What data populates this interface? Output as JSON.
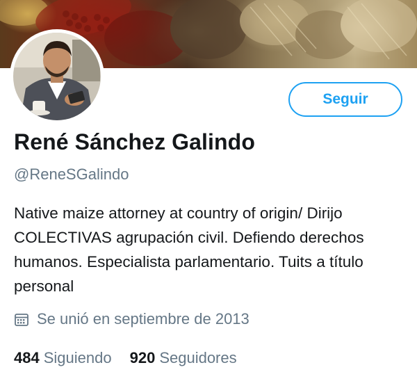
{
  "profile": {
    "name": "René Sánchez Galindo",
    "handle": "@ReneSGalindo",
    "bio": "Native maize attorney at country of origin/ Dirijo COLECTIVAS agrupación civil. Defiendo derechos humanos. Especialista parlamentario. Tuits a título personal",
    "joined": "Se unió en septiembre de 2013",
    "joined_icon": "calendar-icon"
  },
  "actions": {
    "follow_label": "Seguir"
  },
  "stats": {
    "following_count": "484",
    "following_label": "Siguiendo",
    "followers_count": "920",
    "followers_label": "Seguidores"
  },
  "colors": {
    "accent": "#1da1f2",
    "text": "#14171a",
    "muted": "#657786"
  }
}
